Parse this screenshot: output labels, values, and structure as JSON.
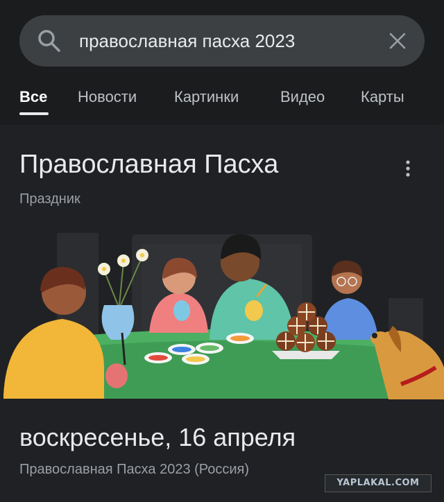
{
  "search": {
    "query": "православная пасха 2023"
  },
  "tabs": [
    {
      "label": "Все",
      "active": true
    },
    {
      "label": "Новости"
    },
    {
      "label": "Картинки"
    },
    {
      "label": "Видео"
    },
    {
      "label": "Карты"
    }
  ],
  "card": {
    "title": "Православная Пасха",
    "subtitle": "Праздник",
    "date": "воскресенье, 16 апреля",
    "date_note": "Православная Пасха 2023 (Россия)"
  },
  "watermark": "YAPLAKAL.COM",
  "colors": {
    "background": "#202124",
    "search_bg": "#3c4043",
    "table_green": "#3f9c55",
    "text_primary": "#e8eaed",
    "text_secondary": "#9aa0a6"
  }
}
